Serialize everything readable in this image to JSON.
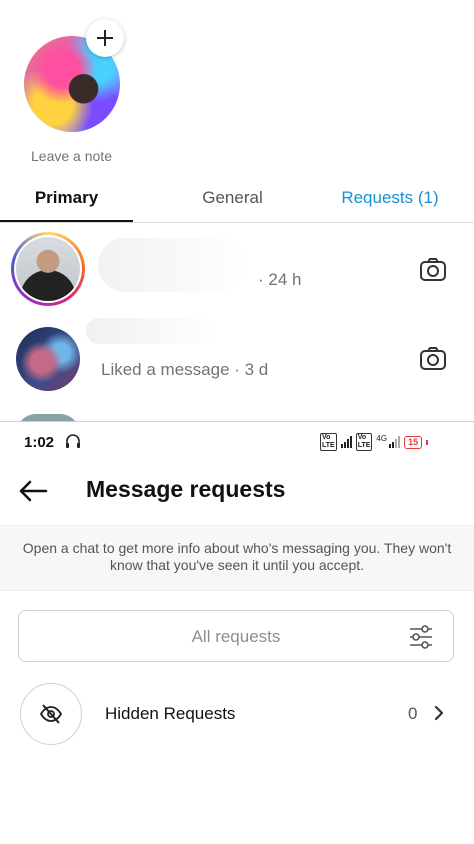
{
  "inbox": {
    "note_label": "Leave a note",
    "tabs": [
      {
        "label": "Primary",
        "active": true
      },
      {
        "label": "General",
        "active": false
      },
      {
        "label": "Requests (1)",
        "active": false
      }
    ],
    "conversations": [
      {
        "meta": "· 24 h",
        "has_story_ring": true,
        "action_icon": "camera-icon"
      },
      {
        "meta": "Liked a message · 3 d",
        "has_story_ring": false,
        "action_icon": "camera-icon"
      }
    ]
  },
  "status_bar": {
    "time": "1:02",
    "network_label": "4G",
    "battery": "15"
  },
  "requests_page": {
    "title": "Message requests",
    "info": "Open a chat to get more info about who's messaging you. They won't know that you've seen it until you accept.",
    "filter_label": "All requests",
    "hidden_requests": {
      "label": "Hidden Requests",
      "count": "0"
    }
  },
  "colors": {
    "accent_blue": "#1691d6",
    "battery_low": "#e23d3d",
    "muted_text": "#737373"
  }
}
